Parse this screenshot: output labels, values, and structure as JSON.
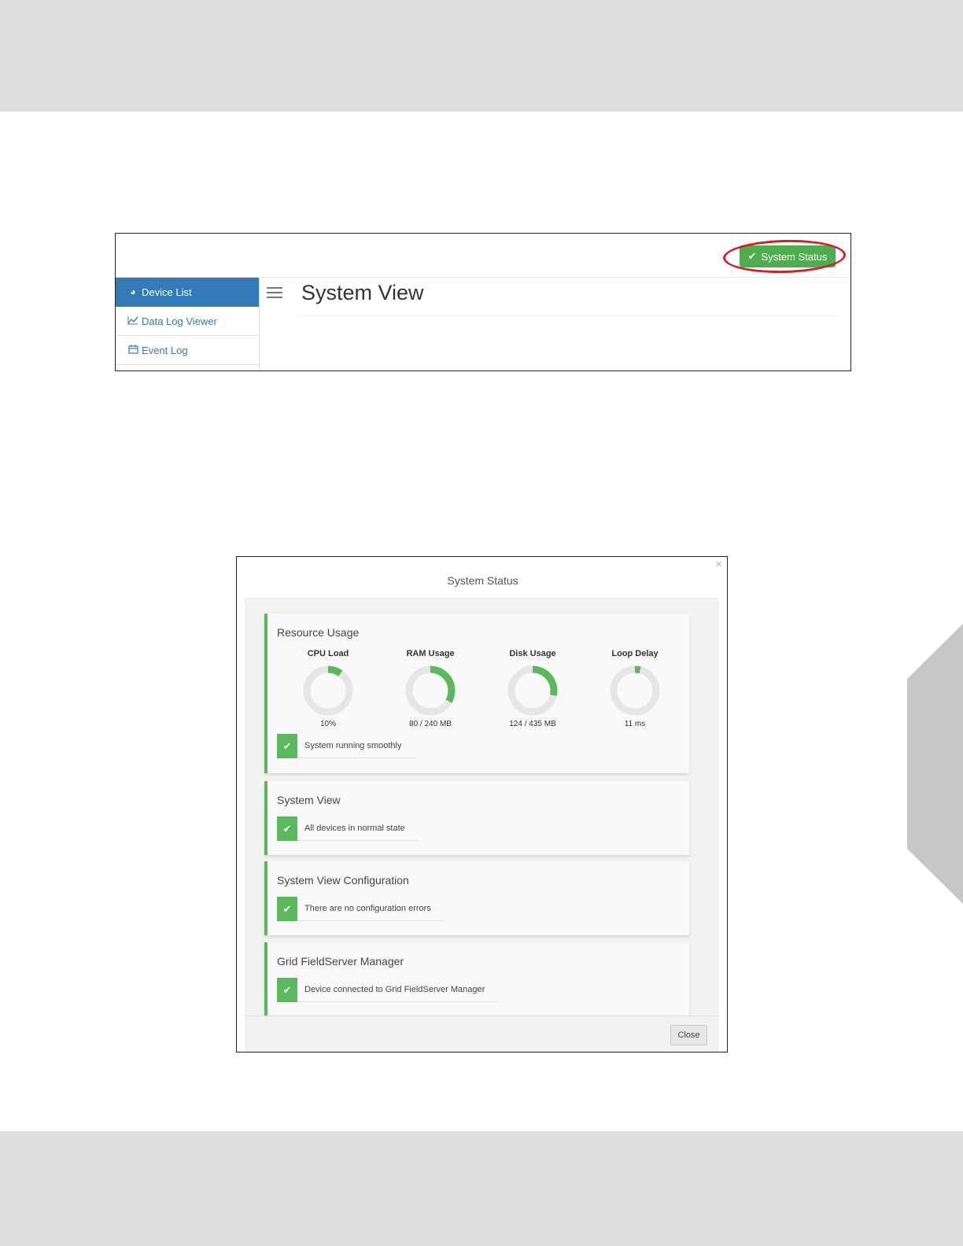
{
  "app": {
    "status_button": {
      "label": "System Status",
      "icon": "check-icon"
    },
    "sidebar": {
      "items": [
        {
          "label": "Device List",
          "icon": "dashboard-icon",
          "active": true
        },
        {
          "label": "Data Log Viewer",
          "icon": "line-chart-icon",
          "active": false
        },
        {
          "label": "Event Log",
          "icon": "calendar-icon",
          "active": false
        }
      ]
    },
    "menu_icon": "hamburger-menu-icon",
    "page_title": "System View"
  },
  "modal": {
    "title": "System Status",
    "close_icon": "×",
    "resource_usage": {
      "title": "Resource Usage",
      "gauges": [
        {
          "label": "CPU Load",
          "value": "10%",
          "fraction": 0.1
        },
        {
          "label": "RAM Usage",
          "value": "80 / 240 MB",
          "fraction": 0.333
        },
        {
          "label": "Disk Usage",
          "value": "124 / 435 MB",
          "fraction": 0.285
        },
        {
          "label": "Loop Delay",
          "value": "11 ms",
          "fraction": 0.04
        }
      ],
      "status": "System running smoothly"
    },
    "system_view": {
      "title": "System View",
      "status": "All devices in normal state"
    },
    "system_view_configuration": {
      "title": "System View Configuration",
      "status": "There are no configuration errors"
    },
    "grid_manager": {
      "title": "Grid FieldServer Manager",
      "status": "Device connected to Grid FieldServer Manager"
    },
    "close_label": "Close"
  },
  "colors": {
    "success": "#5cb85c",
    "primary": "#337ab7",
    "highlight": "#d31f27",
    "gauge_track": "#e6e6e6"
  }
}
